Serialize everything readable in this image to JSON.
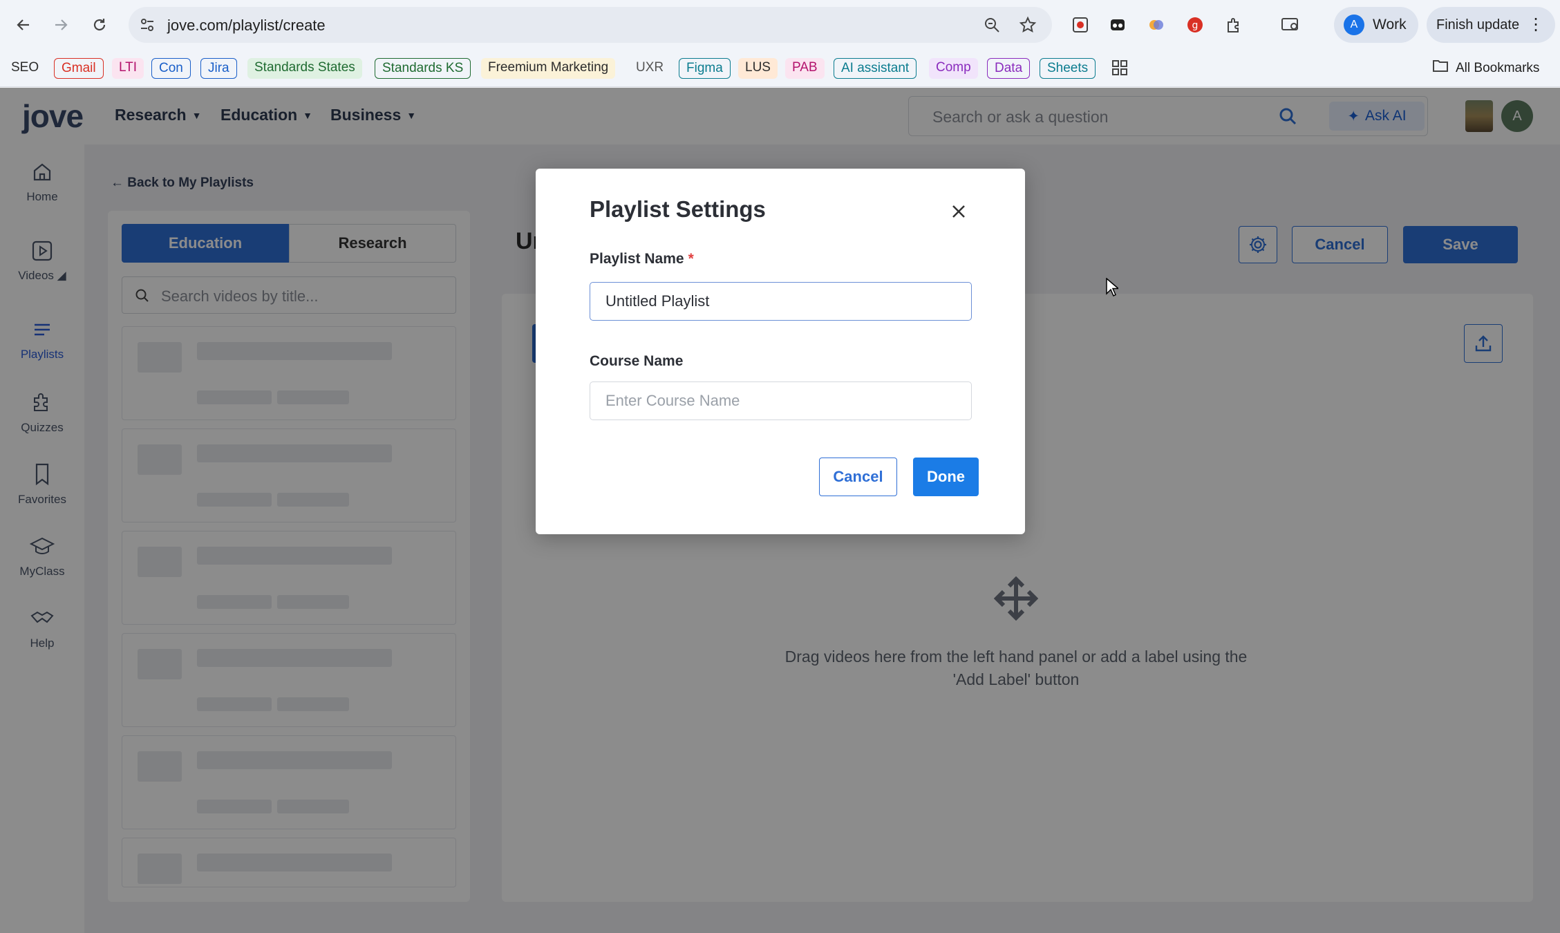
{
  "browser": {
    "url": "jove.com/playlist/create",
    "profile_initial": "A",
    "profile_label": "Work",
    "update_label": "Finish update",
    "menu_glyph": "⋮"
  },
  "bookmarks": [
    {
      "label": "SEO",
      "style": "plain",
      "color": "#2c2c2c",
      "bg": ""
    },
    {
      "label": "Gmail",
      "style": "out",
      "color": "#d93025",
      "bg": ""
    },
    {
      "label": "LTI",
      "style": "fill",
      "color": "#b3136d",
      "bg": "#fbe4f0"
    },
    {
      "label": "Con",
      "style": "out",
      "color": "#1a5fc9",
      "bg": ""
    },
    {
      "label": "Jira",
      "style": "out",
      "color": "#1a5fc9",
      "bg": ""
    },
    {
      "label": "Standards States",
      "style": "fill",
      "color": "#1f6b31",
      "bg": "#dff1e2"
    },
    {
      "label": "Standards KS",
      "style": "out",
      "color": "#1f6b31",
      "bg": ""
    },
    {
      "label": "Freemium Marketing",
      "style": "fill",
      "color": "#2c2c2c",
      "bg": "#fbf2d8"
    },
    {
      "label": "UXR",
      "style": "plain",
      "color": "#555555",
      "bg": ""
    },
    {
      "label": "Figma",
      "style": "out",
      "color": "#0b7c8f",
      "bg": ""
    },
    {
      "label": "LUS",
      "style": "fill",
      "color": "#2c2c2c",
      "bg": "#ffe9d6"
    },
    {
      "label": "PAB",
      "style": "fill",
      "color": "#b3136d",
      "bg": "#fbe4f0"
    },
    {
      "label": "AI assistant",
      "style": "out",
      "color": "#0b7c8f",
      "bg": ""
    },
    {
      "label": "Comp",
      "style": "fill",
      "color": "#8a2bbd",
      "bg": "#f1e4fb"
    },
    {
      "label": "Data",
      "style": "out",
      "color": "#8a2bbd",
      "bg": ""
    },
    {
      "label": "Sheets",
      "style": "out",
      "color": "#0b7c8f",
      "bg": ""
    }
  ],
  "all_bookmarks_label": "All Bookmarks",
  "header": {
    "logo": "jove",
    "nav": [
      "Research",
      "Education",
      "Business"
    ],
    "search_placeholder": "Search or ask a question",
    "ask_ai": "Ask AI",
    "user_initial": "A"
  },
  "sidebar": {
    "items": [
      {
        "label": "Home",
        "icon": "home-icon"
      },
      {
        "label": "Videos ◢",
        "icon": "play-icon"
      },
      {
        "label": "Playlists",
        "icon": "playlist-icon"
      },
      {
        "label": "Quizzes",
        "icon": "puzzle-icon"
      },
      {
        "label": "Favorites",
        "icon": "bookmark-icon"
      },
      {
        "label": "MyClass",
        "icon": "graduation-cap-icon"
      },
      {
        "label": "Help",
        "icon": "handshake-icon"
      }
    ]
  },
  "main": {
    "back_label": "Back to My Playlists",
    "tabs": [
      "Education",
      "Research"
    ],
    "video_search_placeholder": "Search videos by title...",
    "title_partial": "Ur",
    "cancel": "Cancel",
    "save": "Save",
    "drop_text": "Drag videos here from the left hand panel or add a label using the 'Add Label' button"
  },
  "modal": {
    "title": "Playlist Settings",
    "playlist_name_label": "Playlist Name",
    "required_mark": "*",
    "playlist_name_value": "Untitled Playlist",
    "course_name_label": "Course Name",
    "course_name_placeholder": "Enter Course Name",
    "cancel": "Cancel",
    "done": "Done"
  },
  "colors": {
    "brand_blue": "#2f6fd6",
    "done_blue": "#1b7ce6",
    "required_red": "#e14141"
  }
}
